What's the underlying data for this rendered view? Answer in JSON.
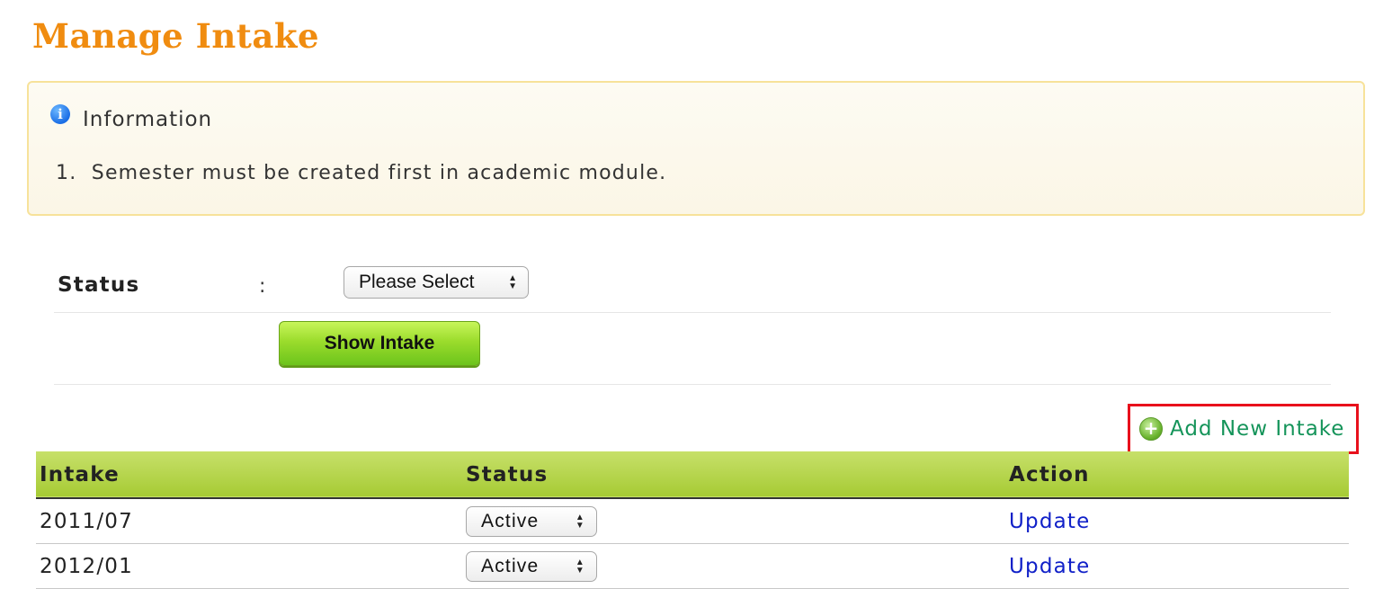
{
  "page": {
    "title": "Manage Intake"
  },
  "info": {
    "icon": "info-icon",
    "heading": "Information",
    "items": [
      "1.  Semester must be created first in academic module."
    ]
  },
  "filter": {
    "status_label": "Status",
    "separator": ":",
    "status_select_value": "Please Select",
    "show_button_label": "Show Intake"
  },
  "add_new": {
    "icon": "add-circle-icon",
    "label": "Add New Intake"
  },
  "table": {
    "headers": [
      "Intake",
      "Status",
      "Action"
    ],
    "rows": [
      {
        "intake": "2011/07",
        "status": "Active",
        "action": "Update"
      },
      {
        "intake": "2012/01",
        "status": "Active",
        "action": "Update"
      }
    ]
  },
  "colors": {
    "title": "#f08c10",
    "info_border": "#f7e29a",
    "button_green": "#9bdc2c",
    "table_header": "#b5d443",
    "add_link": "#15945a",
    "highlight_border": "#e8101c",
    "update_link": "#1020c8"
  }
}
